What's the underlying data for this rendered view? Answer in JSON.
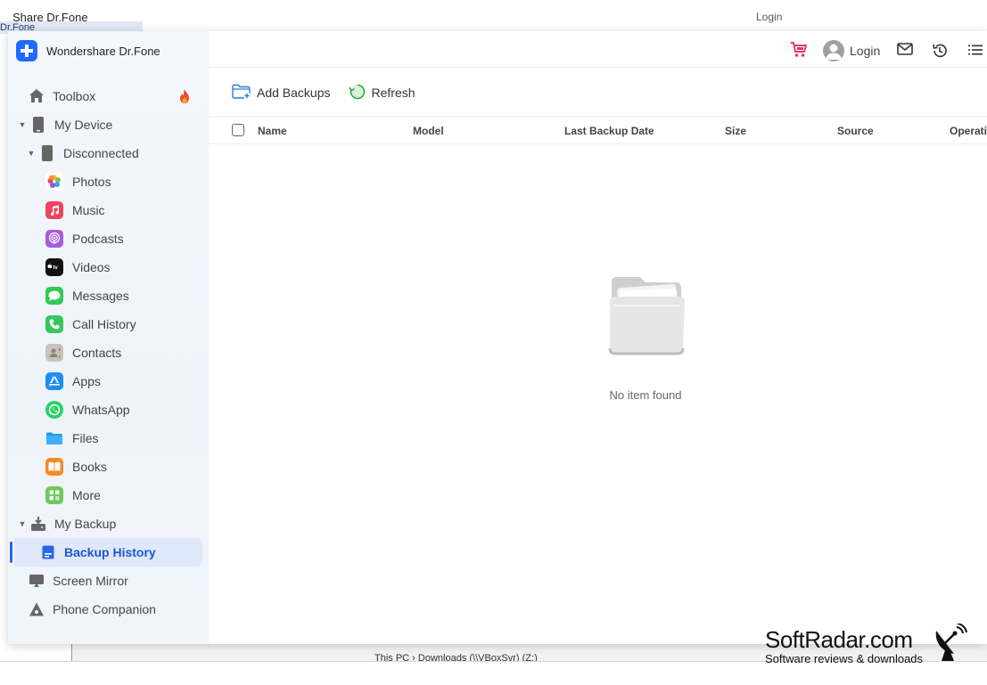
{
  "background": {
    "title_fragment": "Share Dr.Fone",
    "tab_fragment": "Dr.Fone",
    "top_login_fragment": "Login",
    "path_fragment": "This PC  ›  Downloads (\\\\VBoxSvr) (Z:)"
  },
  "app": {
    "brand_name": "Wondershare Dr.Fone",
    "header": {
      "login_label": "Login"
    },
    "sidebar": {
      "toolbox": "Toolbox",
      "my_device": "My Device",
      "disconnected": "Disconnected",
      "items": [
        {
          "label": "Photos",
          "icon": "photos-icon"
        },
        {
          "label": "Music",
          "icon": "music-icon"
        },
        {
          "label": "Podcasts",
          "icon": "podcasts-icon"
        },
        {
          "label": "Videos",
          "icon": "tv-icon"
        },
        {
          "label": "Messages",
          "icon": "messages-icon"
        },
        {
          "label": "Call History",
          "icon": "phone-icon"
        },
        {
          "label": "Contacts",
          "icon": "contacts-icon"
        },
        {
          "label": "Apps",
          "icon": "app-store-icon"
        },
        {
          "label": "WhatsApp",
          "icon": "whatsapp-icon"
        },
        {
          "label": "Files",
          "icon": "folder-icon"
        },
        {
          "label": "Books",
          "icon": "books-icon"
        },
        {
          "label": "More",
          "icon": "more-icon"
        }
      ],
      "my_backup": "My Backup",
      "backup_history": "Backup History",
      "screen_mirror": "Screen Mirror",
      "phone_companion": "Phone Companion"
    },
    "toolbar": {
      "add_backups": "Add Backups",
      "refresh": "Refresh"
    },
    "table": {
      "columns": [
        "Name",
        "Model",
        "Last Backup Date",
        "Size",
        "Source",
        "Operation"
      ]
    },
    "empty_state": "No item found"
  },
  "watermark": {
    "title": "SoftRadar.com",
    "subtitle": "Software reviews & downloads"
  },
  "colors": {
    "accent": "#1f6bff",
    "active_bg": "#dfe8fb",
    "active_text": "#1b57d4",
    "cart": "#e8386b",
    "fire": "#f04a2a"
  }
}
